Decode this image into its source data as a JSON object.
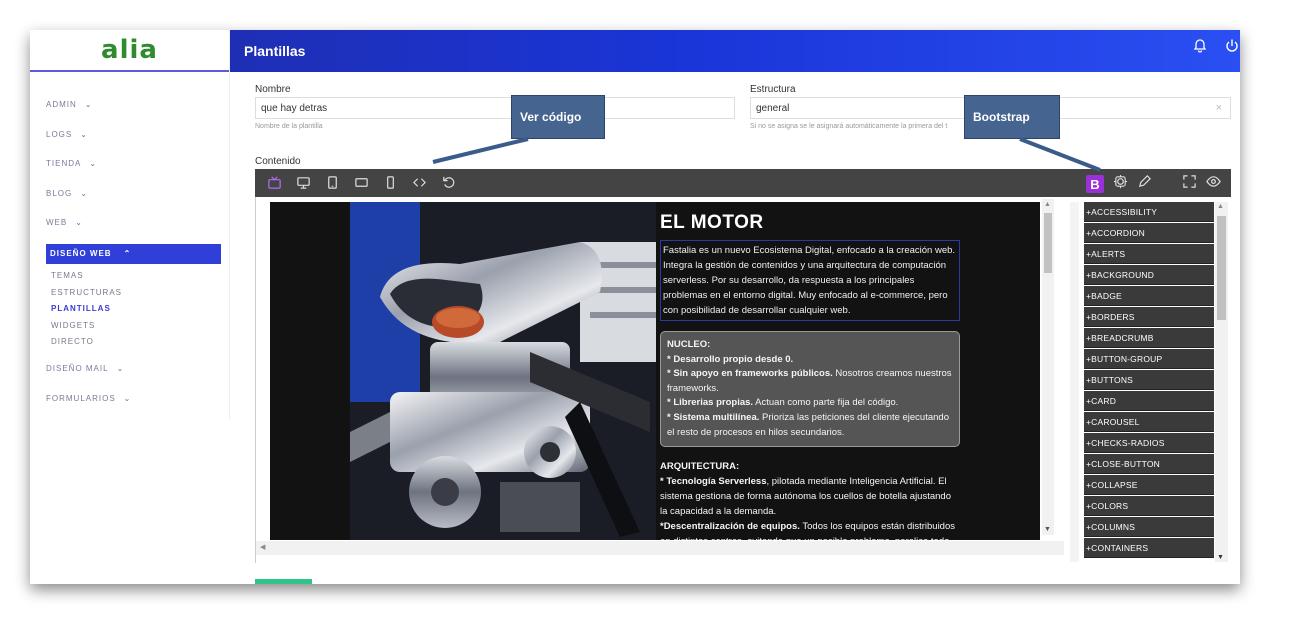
{
  "logo": "alia",
  "sidebar": {
    "items": [
      {
        "label": "ADMIN"
      },
      {
        "label": "LOGS"
      },
      {
        "label": "TIENDA"
      },
      {
        "label": "BLOG"
      },
      {
        "label": "WEB"
      }
    ],
    "active": "DISEÑO WEB",
    "subitems": [
      "TEMAS",
      "ESTRUCTURAS",
      "PLANTILLAS",
      "WIDGETS",
      "DIRECTO"
    ],
    "after": [
      "DISEÑO MAIL",
      "FORMULARIOS"
    ]
  },
  "header": {
    "title": "Plantillas"
  },
  "form": {
    "nombre_label": "Nombre",
    "nombre_value": "que hay detras",
    "nombre_hint": "Nombre de la plantilla",
    "estructura_label": "Estructura",
    "estructura_value": "general",
    "estructura_hint": "Si no se asigna se le asignará automáticamente la primera del t",
    "clear": "×",
    "contenido_label": "Contenido"
  },
  "toolbar": {
    "bootstrap_letter": "B"
  },
  "article": {
    "title": "EL MOTOR",
    "intro": "Fastalia es un nuevo Ecosistema Digital, enfocado a la creación web. Integra la gestión de contenidos y una arquitectura de computación serverless.  Por su desarrollo, da respuesta a los principales problemas en el entorno digital. Muy enfocado al e-commerce, pero con posibilidad de desarrollar cualquier web.",
    "box_title": "NUCLEO:",
    "box_lines": [
      {
        "bold": "* Desarrollo propio desde 0.",
        "text": ""
      },
      {
        "bold": "* Sin apoyo en frameworks públicos.",
        "text": " Nosotros creamos nuestros frameworks."
      },
      {
        "bold": "* Librerias propias.",
        "text": " Actuan como parte fija del código."
      },
      {
        "bold": "* Sistema multilínea.",
        "text": " Prioriza las peticiones del cliente ejecutando el resto de procesos en hilos secundarios."
      }
    ],
    "arq_title": "ARQUITECTURA:",
    "arq_lines": [
      {
        "bold": "* Tecnología Serverless",
        "text": ", pilotada mediante Inteligencia Artificial. El sistema gestiona de forma autónoma los cuellos de botella ajustando la capacidad a la demanda."
      },
      {
        "bold": "*Descentralización de equipos.",
        "text": " Todos los equipos están distribuidos en distintos centros, evitando que un posible problema, paralice todo"
      }
    ]
  },
  "components": [
    "+ACCESSIBILITY",
    "+ACCORDION",
    "+ALERTS",
    "+BACKGROUND",
    "+BADGE",
    "+BORDERS",
    "+BREADCRUMB",
    "+BUTTON-GROUP",
    "+BUTTONS",
    "+CARD",
    "+CAROUSEL",
    "+CHECKS-RADIOS",
    "+CLOSE-BUTTON",
    "+COLLAPSE",
    "+COLORS",
    "+COLUMNS",
    "+CONTAINERS"
  ],
  "callouts": {
    "ver_codigo": "Ver código",
    "bootstrap": "Bootstrap"
  },
  "colors": {
    "header": "#1a35d8",
    "active_nav": "#2f3fd8",
    "bootstrap_badge": "#9b30d9",
    "callout": "#45648f",
    "save_button": "#2fc48a"
  }
}
